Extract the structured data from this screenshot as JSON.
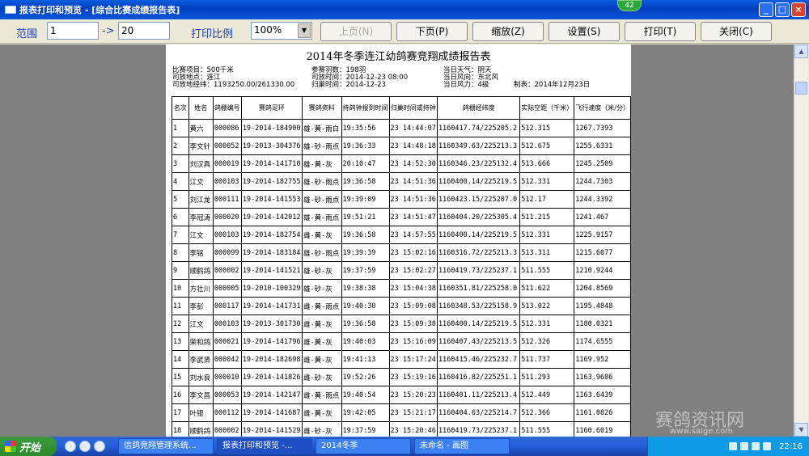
{
  "window": {
    "title": "报表打印和预览 - [综合比赛成绩报告表]",
    "badge": "42",
    "buttons": [
      "_",
      "□",
      "×"
    ]
  },
  "toolbar": {
    "range_label": "范围",
    "range_from": "1",
    "range_arrow": "->",
    "range_to": "20",
    "scale_label": "打印比例",
    "scale_value": "100%",
    "prev_page": "上页(N)",
    "next_page": "下页(P)",
    "zoom": "缩放(Z)",
    "settings": "设置(S)",
    "print": "打印(T)",
    "close": "关闭(C)"
  },
  "report": {
    "title": "2014年冬季连江幼鸽赛竞翔成绩报告表",
    "meta": {
      "project": "比赛项目：500千米",
      "release_place": "司放地点：连江",
      "release_coords": "司放地经纬：1193250.00/261330.00",
      "participants": "参赛羽数：198羽",
      "release_time": "司放时间：2014-12-23 08:00",
      "arrival_time": "归巢时间：2014-12-23",
      "weather": "当日天气：阴天",
      "wind_dir": "当日风向：东北风",
      "wind_force": "当日风力：4级",
      "made": "制表：2014年12月23日"
    },
    "headers": [
      "名次",
      "姓名",
      "鸽棚编号",
      "赛鸽足环",
      "赛鸽资料",
      "持鸽钟报到时间",
      "归巢时间或持钟",
      "鸽棚经纬度",
      "实际空距（千米）",
      "飞行速度（米/分）"
    ],
    "rows": [
      [
        "1",
        "黄六",
        "000086",
        "19-2014-184900",
        "雄-黄-雨白",
        "19:35:56",
        "23 14:44:07",
        "1160417.74/225205.2",
        "512.315",
        "1267.7393"
      ],
      [
        "2",
        "李文针",
        "000052",
        "19-2013-304376",
        "雄-砂-雨点",
        "19:36:33",
        "23 14:48:18",
        "1160349.63/225213.3",
        "512.675",
        "1255.6331"
      ],
      [
        "3",
        "刘汉真",
        "000019",
        "19-2014-141710",
        "雄-黄-灰",
        "20:10:47",
        "23 14:52:30",
        "1160346.23/225132.4",
        "513.666",
        "1245.2509"
      ],
      [
        "4",
        "江文",
        "000103",
        "19-2014-182755",
        "雄-砂-雨点",
        "19:36:58",
        "23 14:51:36",
        "1160400.14/225219.5",
        "512.331",
        "1244.7303"
      ],
      [
        "5",
        "刘江龙",
        "000111",
        "19-2014-141553",
        "雄-砂-雨点",
        "19:39:09",
        "23 14:51:36",
        "1160423.15/225207.0",
        "512.17",
        "1244.3392"
      ],
      [
        "6",
        "李冠涛",
        "000020",
        "19-2014-142012",
        "雄-黄-雨点",
        "19:51:21",
        "23 14:51:47",
        "1160404.20/225305.4",
        "511.215",
        "1241.467"
      ],
      [
        "7",
        "江文",
        "000103",
        "19-2014-182754",
        "雌-黄-灰",
        "19:36:58",
        "23 14:57:55",
        "1160400.14/225219.5",
        "512.331",
        "1225.9157"
      ],
      [
        "8",
        "李铭",
        "000099",
        "19-2014-183184",
        "雄-砂-雨点",
        "19:39:39",
        "23 15:02:16",
        "1160316.72/225213.3",
        "513.311",
        "1215.6077"
      ],
      [
        "9",
        "顺鹤鸽",
        "000002",
        "19-2014-141521",
        "雄-砂-灰",
        "19:37:59",
        "23 15:02:27",
        "1160419.73/225237.1",
        "511.555",
        "1210.9244"
      ],
      [
        "10",
        "方壮川",
        "000005",
        "19-2010-100329",
        "雄-砂-灰",
        "19:38:38",
        "23 15:04:38",
        "1160351.81/225258.0",
        "511.622",
        "1204.8569"
      ],
      [
        "11",
        "李彭",
        "000117",
        "19-2014-141731",
        "雌-黄-雨点",
        "19:40:30",
        "23 15:09:08",
        "1160348.53/225158.9",
        "513.022",
        "1195.4848"
      ],
      [
        "12",
        "江文",
        "000103",
        "19-2013-301730",
        "雌-黄-灰",
        "19:36:58",
        "23 15:09:38",
        "1160400.14/225219.5",
        "512.331",
        "1180.0321"
      ],
      [
        "13",
        "荣和鸽",
        "000021",
        "19-2014-141796",
        "雌-黄-灰",
        "19:40:03",
        "23 15:16:09",
        "1160407.43/225213.5",
        "512.326",
        "1174.6555"
      ],
      [
        "14",
        "李武贤",
        "000042",
        "19-2014-182698",
        "雌-黄-灰",
        "19:41:13",
        "23 15:17:24",
        "1160415.46/225232.7",
        "511.737",
        "1169.952"
      ],
      [
        "15",
        "刘水良",
        "000010",
        "19-2014-141826",
        "雌-砂-灰",
        "19:52:26",
        "23 15:19:16",
        "1160416.82/225251.1",
        "511.293",
        "1163.9686"
      ],
      [
        "16",
        "李文昌",
        "000053",
        "19-2014-142147",
        "雌-黄-雨点",
        "19:40:54",
        "23 15:20:23",
        "1160401.11/225213.4",
        "512.449",
        "1163.6439"
      ],
      [
        "17",
        "叶银",
        "000112",
        "19-2014-141687",
        "雌-黄-灰",
        "19:42:05",
        "23 15:21:17",
        "1160404.63/225214.7",
        "512.366",
        "1161.0826"
      ],
      [
        "18",
        "顺鹤鸽",
        "000002",
        "19-2014-141529",
        "雌-砂-灰",
        "19:37:59",
        "23 15:20:46",
        "1160419.73/225237.1",
        "511.555",
        "1160.6019"
      ],
      [
        "19",
        "刘江龙",
        "000111",
        "19-2014-141559",
        "雌-黄-雨点",
        "19:39:09",
        "23 15:21:53",
        "1160423.15/225207.0",
        "512.17",
        "1159.0625"
      ],
      [
        "20",
        "蔡宏良",
        "000047",
        "19-2014-141981",
        "雄-砂-雨点",
        "19:43:11",
        "23 15:21:26",
        "1160401.43/225252.5",
        "511.56",
        "1158.8622"
      ]
    ]
  },
  "taskbar": {
    "start": "开始",
    "tasks": [
      "信鸽竞翔管理系统...",
      "报表打印和预览 -...",
      "2014冬季",
      "未命名 - 画图"
    ],
    "clock": "22:16"
  },
  "watermark": {
    "text": "赛鸽资讯网",
    "url": "www.saige.com"
  }
}
